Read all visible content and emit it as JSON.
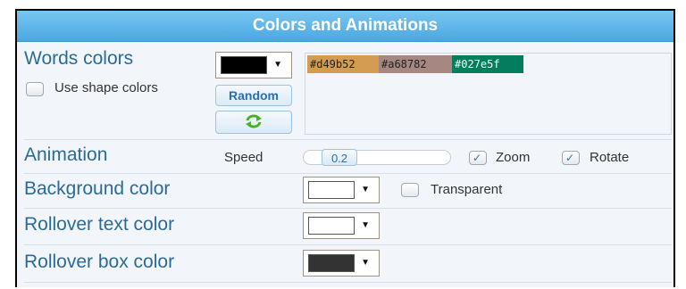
{
  "header": {
    "title": "Colors and Animations"
  },
  "words_colors": {
    "label": "Words colors",
    "selected_color": "#000000",
    "use_shape_colors_label": "Use shape colors",
    "use_shape_colors_checked": false,
    "random_button": "Random",
    "refresh_icon": "refresh-icon",
    "palette": [
      {
        "hex": "#d49b52",
        "text_color": "#222222"
      },
      {
        "hex": "#a68782",
        "text_color": "#222222"
      },
      {
        "hex": "#027e5f",
        "text_color": "#ffffff"
      }
    ]
  },
  "animation": {
    "label": "Animation",
    "speed_label": "Speed",
    "speed_value": "0.2",
    "zoom_label": "Zoom",
    "zoom_checked": true,
    "rotate_label": "Rotate",
    "rotate_checked": true
  },
  "background": {
    "label": "Background color",
    "selected_color": "#ffffff",
    "transparent_label": "Transparent",
    "transparent_checked": false
  },
  "rollover_text": {
    "label": "Rollover text color",
    "selected_color": "#ffffff"
  },
  "rollover_box": {
    "label": "Rollover box color",
    "selected_color": "#333333"
  }
}
